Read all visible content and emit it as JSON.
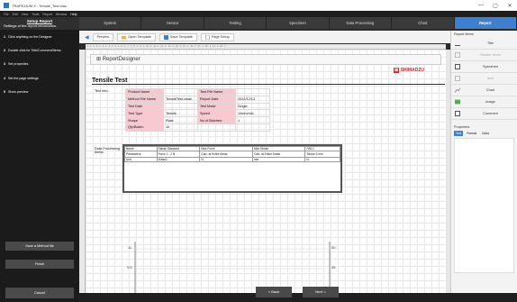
{
  "window": {
    "title": "TRAPEZIUM X - Tensile_Test.xtac",
    "min": "—",
    "max": "▢",
    "close": "✕"
  },
  "menubar": [
    "File",
    "Edit",
    "View",
    "Tools",
    "Report",
    "Window",
    "Help"
  ],
  "left_panel": {
    "title": "Setup Report",
    "subtitle": "Settings of the report information.",
    "steps": [
      {
        "num": "1",
        "text": "Click anything on the Designer"
      },
      {
        "num": "2",
        "text": "Double click for Title/Comment/Items"
      },
      {
        "num": "3",
        "text": "Set properties"
      },
      {
        "num": "4",
        "text": "Set the page settings"
      },
      {
        "num": "5",
        "text": "Show preview"
      }
    ],
    "save_button": "Save a Method file",
    "finish_button": "Finish",
    "cancel_button": "Cancel"
  },
  "tabs": [
    "System",
    "Sensor",
    "Testing",
    "Specimen",
    "Data Processing",
    "Chart",
    "Report"
  ],
  "active_tab": "Report",
  "toolbar": {
    "preview": "Preview",
    "open_template": "Open Template",
    "save_template": "Save Template",
    "page_setup": "Page Setup"
  },
  "ruler_text": "· 1 · 1 · 1 · 2 · 1 · 3 · 1 · 4 · 1 · 5 · 1 · 6 · 1 · 7 · 1 · 8 · 1 · 9 · 1 · 10 · 1 · 11 · 1 · 12 · 1 · 13 · 1 · 14 · 1 · 15 · 1 · 16 · 1 · 17 · 1 · 18 · 1 · 19 · 1 · 20 · 1 ·",
  "designer": {
    "name": "ReportDesigner",
    "logo": "SHIMADZU",
    "report_title": "Tensile Test",
    "test_info_label": "Test Info.:",
    "info_rows": [
      [
        "Product Name",
        "",
        "Test File Name",
        ""
      ],
      [
        "Method File Name",
        "TensileTest.xmak",
        "Report Date",
        "2022/12/13"
      ],
      [
        "Test Date",
        "",
        "Test Mode",
        "Single"
      ],
      [
        "Test Type",
        "Tensile",
        "Speed",
        "10mm/min"
      ],
      [
        "Shape",
        "Plate",
        "No of Batches:",
        "1"
      ],
      [
        "Qty/Batch:",
        "10",
        "",
        ""
      ]
    ],
    "dp_label": "Data Processing Items:",
    "dp_rows": [
      [
        "Name",
        "Elastic Standard",
        "Max Force",
        "Max Stroke",
        "FAIL1"
      ],
      [
        "Parameters",
        "Force 1 - 2 N",
        "Calc. at Entire Areas",
        "Calc. at Entire Areas",
        "Stroke 5 mm"
      ],
      [
        "Unit",
        "N/mm2",
        "N",
        "mm",
        "N"
      ]
    ],
    "chart_axis": {
      "left_top": "11",
      "left_bottom": "9.5",
      "right_top": "50",
      "right_bottom": "45"
    }
  },
  "right_panel": {
    "title": "Report Items",
    "items": [
      {
        "label": "Title",
        "icon": "title-icon",
        "enabled": true
      },
      {
        "label": "Header Items",
        "icon": "header-icon",
        "enabled": false
      },
      {
        "label": "Specimen",
        "icon": "specimen-icon",
        "enabled": true
      },
      {
        "label": "Item",
        "icon": "item-icon",
        "enabled": false
      },
      {
        "label": "Chart",
        "icon": "chart-icon",
        "enabled": true
      },
      {
        "label": "Image",
        "icon": "image-icon",
        "enabled": true
      },
      {
        "label": "Comment",
        "icon": "comment-icon",
        "enabled": true
      }
    ],
    "properties_title": "Properties",
    "properties_tabs": [
      "Text",
      "Format",
      "Color"
    ]
  },
  "nav": {
    "back": "< Back",
    "next": "Next >"
  }
}
